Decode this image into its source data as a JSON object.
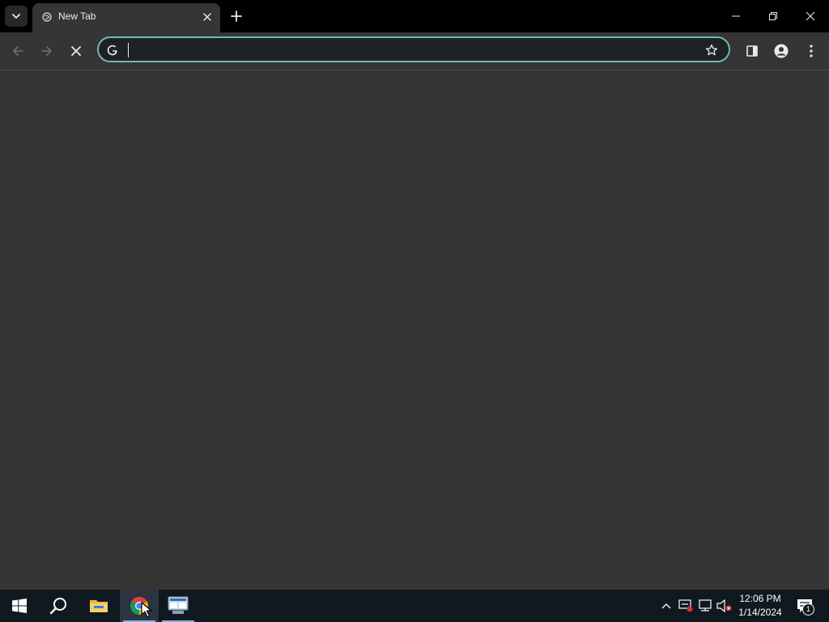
{
  "browser": {
    "tabs": [
      {
        "title": "New Tab",
        "active": true,
        "loading": true
      }
    ],
    "omnibox": {
      "value": "",
      "placeholder": ""
    },
    "icons": {
      "tab_search": "chevron-down-icon",
      "favicon": "loading-globe-icon",
      "tab_close": "close-icon",
      "new_tab": "plus-icon",
      "back": "arrow-left-icon",
      "forward": "arrow-right-icon",
      "stop": "close-icon",
      "search_engine": "google-g-icon",
      "bookmark": "star-icon",
      "side_panel": "side-panel-icon",
      "profile": "person-icon",
      "menu": "kebab-icon"
    },
    "colors": {
      "background": "#353535",
      "omnibox_focus": "#73b8b0",
      "titlebar": "#000000"
    }
  },
  "taskbar": {
    "apps": [
      {
        "name": "start",
        "icon": "windows-icon"
      },
      {
        "name": "search",
        "icon": "search-icon"
      },
      {
        "name": "file-explorer",
        "icon": "folder-icon"
      },
      {
        "name": "chrome",
        "icon": "chrome-icon",
        "active": true
      },
      {
        "name": "server-manager",
        "icon": "server-icon"
      }
    ],
    "tray": {
      "icons": [
        "chevron-up-icon",
        "security-icon",
        "network-icon",
        "volume-muted-icon"
      ]
    },
    "clock": {
      "time": "12:06 PM",
      "date": "1/14/2024"
    },
    "notifications": {
      "count": "1"
    }
  }
}
